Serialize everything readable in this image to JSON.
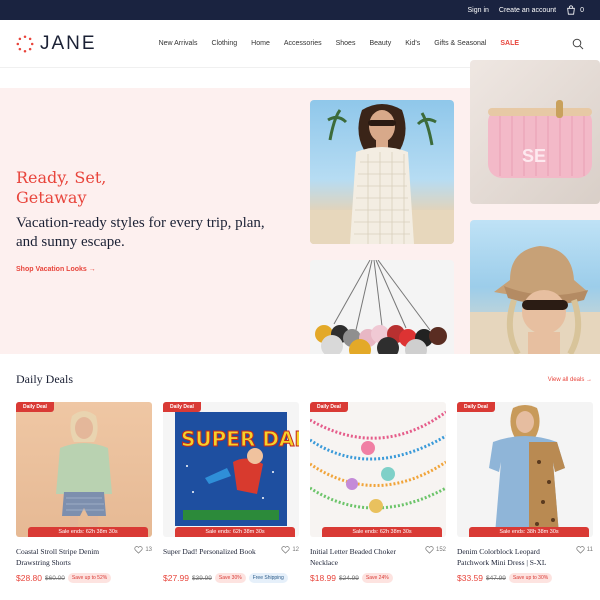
{
  "topbar": {
    "sign_in": "Sign in",
    "create_account": "Create an account",
    "cart_count": "0"
  },
  "brand": {
    "name": "JANE",
    "accent": "#e8453c",
    "navy": "#1a2340"
  },
  "nav": [
    "New Arrivals",
    "Clothing",
    "Home",
    "Accessories",
    "Shoes",
    "Beauty",
    "Kid's",
    "Gifts & Seasonal",
    "SALE"
  ],
  "hero": {
    "title": "Ready, Set, Getaway",
    "subtitle": "Vacation-ready styles for every trip, plan, and sunny escape.",
    "link": "Shop Vacation Looks →"
  },
  "deals": {
    "title": "Daily Deals",
    "view_all": "View all deals →",
    "items": [
      {
        "badge": "Daily Deal",
        "timer": "Sale ends: 62h 38m 30s",
        "name": "Coastal Stroll Stripe Denim Drawstring Shorts",
        "likes": "13",
        "price": "$28.80",
        "old_price": "$60.00",
        "save": "Save up to 52%",
        "ship": ""
      },
      {
        "badge": "Daily Deal",
        "timer": "Sale ends: 62h 38m 30s",
        "name": "Super Dad! Personalized Book",
        "likes": "12",
        "price": "$27.99",
        "old_price": "$39.99",
        "save": "Save 30%",
        "ship": "Free Shipping"
      },
      {
        "badge": "Daily Deal",
        "timer": "Sale ends: 62h 38m 30s",
        "name": "Initial Letter Beaded Choker Necklace",
        "likes": "152",
        "price": "$18.99",
        "old_price": "$24.99",
        "save": "Save 24%",
        "ship": ""
      },
      {
        "badge": "Daily Deal",
        "timer": "Sale ends: 38h 38m 30s",
        "name": "Denim Colorblock Leopard Patchwork Mini Dress | S-XL",
        "likes": "11",
        "price": "$33.59",
        "old_price": "$47.99",
        "save": "Save up to 30%",
        "ship": ""
      }
    ]
  },
  "images": {
    "tile2_monogram": "SE",
    "book_cover": "SUPER DAD!"
  }
}
